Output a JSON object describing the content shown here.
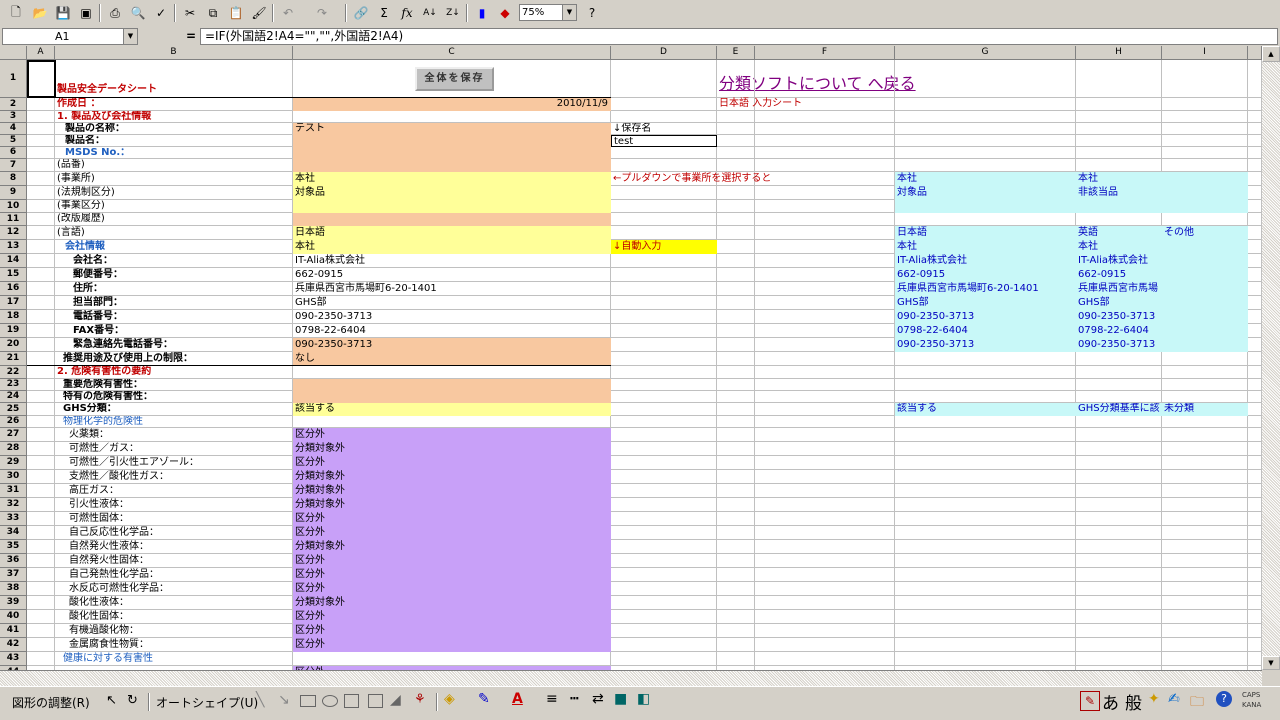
{
  "formula_bar": {
    "cell_ref": "A1",
    "formula": "=IF(外国語2!A4=\"\",\"\",外国語2!A4)"
  },
  "toolbar": {
    "zoom": "75%"
  },
  "columns": [
    "A",
    "B",
    "C",
    "D",
    "E",
    "F",
    "G",
    "H",
    "I"
  ],
  "save_button": "全体を保存",
  "back_link": "分類ソフトについて へ戻る",
  "rows": [
    {
      "n": "1",
      "b": "製品安全データシート",
      "c": "",
      "d": "",
      "g": "",
      "h": "",
      "i": ""
    },
    {
      "n": "2",
      "b": "作成日 ：",
      "c": "2010/11/9",
      "d": "",
      "e": "日本語 入力シート",
      "g": "",
      "h": "",
      "i": ""
    },
    {
      "n": "3",
      "b": "1. 製品及び会社情報",
      "c": "",
      "d": "",
      "g": "",
      "h": "",
      "i": ""
    },
    {
      "n": "4",
      "b": "製品の名称：",
      "c": "テスト",
      "d": "↓保存名",
      "g": "",
      "h": "",
      "i": ""
    },
    {
      "n": "5",
      "b": "製品名：",
      "c": "",
      "d": "test",
      "g": "",
      "h": "",
      "i": ""
    },
    {
      "n": "6",
      "b": "MSDS No.：",
      "c": "",
      "d": "",
      "g": "",
      "h": "",
      "i": ""
    },
    {
      "n": "7",
      "b": "(品番)",
      "c": "",
      "d": "",
      "g": "",
      "h": "",
      "i": ""
    },
    {
      "n": "8",
      "b": "(事業所)",
      "c": "本社",
      "d": "←プルダウンで事業所を選択すると",
      "g": "本社",
      "h": "本社",
      "i": ""
    },
    {
      "n": "9",
      "b": "(法規制区分)",
      "c": "対象品",
      "d": "",
      "g": "対象品",
      "h": "非該当品",
      "i": ""
    },
    {
      "n": "10",
      "b": "(事業区分)",
      "c": "",
      "d": "",
      "g": "",
      "h": "",
      "i": ""
    },
    {
      "n": "11",
      "b": "(改版履歴)",
      "c": "",
      "d": "",
      "g": "",
      "h": "",
      "i": ""
    },
    {
      "n": "12",
      "b": "(言語)",
      "c": "日本語",
      "d": "",
      "g": "日本語",
      "h": "英語",
      "i": "その他"
    },
    {
      "n": "13",
      "b": "会社情報",
      "c": "本社",
      "d": "↓自動入力",
      "g": "本社",
      "h": "本社",
      "i": ""
    },
    {
      "n": "14",
      "b": "会社名：",
      "c": "IT-Alia株式会社",
      "d": "",
      "g": "IT-Alia株式会社",
      "h": "IT-Alia株式会社",
      "i": ""
    },
    {
      "n": "15",
      "b": "郵便番号：",
      "c": "662-0915",
      "d": "",
      "g": "662-0915",
      "h": "662-0915",
      "i": ""
    },
    {
      "n": "16",
      "b": "住所：",
      "c": "兵庫県西宮市馬場町6-20-1401",
      "d": "",
      "g": "兵庫県西宮市馬場町6-20-1401",
      "h": "兵庫県西宮市馬場",
      "i": ""
    },
    {
      "n": "17",
      "b": "担当部門：",
      "c": "GHS部",
      "d": "",
      "g": "GHS部",
      "h": "GHS部",
      "i": ""
    },
    {
      "n": "18",
      "b": "電話番号：",
      "c": "090-2350-3713",
      "d": "",
      "g": "090-2350-3713",
      "h": "090-2350-3713",
      "i": ""
    },
    {
      "n": "19",
      "b": "FAX番号：",
      "c": "0798-22-6404",
      "d": "",
      "g": "0798-22-6404",
      "h": "0798-22-6404",
      "i": ""
    },
    {
      "n": "20",
      "b": "緊急連絡先電話番号：",
      "c": "090-2350-3713",
      "d": "",
      "g": "090-2350-3713",
      "h": "090-2350-3713",
      "i": ""
    },
    {
      "n": "21",
      "b": "推奨用途及び使用上の制限：",
      "c": "なし",
      "d": "",
      "g": "",
      "h": "",
      "i": ""
    },
    {
      "n": "22",
      "b": "2. 危険有害性の要約",
      "c": "",
      "d": "",
      "g": "",
      "h": "",
      "i": ""
    },
    {
      "n": "23",
      "b": "重要危険有害性：",
      "c": "",
      "d": "",
      "g": "",
      "h": "",
      "i": ""
    },
    {
      "n": "24",
      "b": "特有の危険有害性：",
      "c": "",
      "d": "",
      "g": "",
      "h": "",
      "i": ""
    },
    {
      "n": "25",
      "b": "GHS分類：",
      "c": "該当する",
      "d": "",
      "g": "該当する",
      "h": "GHS分類基準に該",
      "i": "未分類"
    },
    {
      "n": "26",
      "b": "物理化学的危険性",
      "c": "",
      "d": "",
      "g": "",
      "h": "",
      "i": ""
    },
    {
      "n": "27",
      "b": "火薬類：",
      "c": "区分外",
      "d": "",
      "g": "",
      "h": "",
      "i": ""
    },
    {
      "n": "28",
      "b": "可燃性／ガス：",
      "c": "分類対象外",
      "d": "",
      "g": "",
      "h": "",
      "i": ""
    },
    {
      "n": "29",
      "b": "可燃性／引火性エアゾール：",
      "c": "区分外",
      "d": "",
      "g": "",
      "h": "",
      "i": ""
    },
    {
      "n": "30",
      "b": "支燃性／酸化性ガス：",
      "c": "分類対象外",
      "d": "",
      "g": "",
      "h": "",
      "i": ""
    },
    {
      "n": "31",
      "b": "高圧ガス：",
      "c": "分類対象外",
      "d": "",
      "g": "",
      "h": "",
      "i": ""
    },
    {
      "n": "32",
      "b": "引火性液体：",
      "c": "分類対象外",
      "d": "",
      "g": "",
      "h": "",
      "i": ""
    },
    {
      "n": "33",
      "b": "可燃性固体：",
      "c": "区分外",
      "d": "",
      "g": "",
      "h": "",
      "i": ""
    },
    {
      "n": "34",
      "b": "自己反応性化学品：",
      "c": "区分外",
      "d": "",
      "g": "",
      "h": "",
      "i": ""
    },
    {
      "n": "35",
      "b": "自然発火性液体：",
      "c": "分類対象外",
      "d": "",
      "g": "",
      "h": "",
      "i": ""
    },
    {
      "n": "36",
      "b": "自然発火性固体：",
      "c": "区分外",
      "d": "",
      "g": "",
      "h": "",
      "i": ""
    },
    {
      "n": "37",
      "b": "自己発熱性化学品：",
      "c": "区分外",
      "d": "",
      "g": "",
      "h": "",
      "i": ""
    },
    {
      "n": "38",
      "b": "水反応可燃性化学品：",
      "c": "区分外",
      "d": "",
      "g": "",
      "h": "",
      "i": ""
    },
    {
      "n": "39",
      "b": "酸化性液体：",
      "c": "分類対象外",
      "d": "",
      "g": "",
      "h": "",
      "i": ""
    },
    {
      "n": "40",
      "b": "酸化性固体：",
      "c": "区分外",
      "d": "",
      "g": "",
      "h": "",
      "i": ""
    },
    {
      "n": "41",
      "b": "有機過酸化物：",
      "c": "区分外",
      "d": "",
      "g": "",
      "h": "",
      "i": ""
    },
    {
      "n": "42",
      "b": "金属腐食性物質：",
      "c": "区分外",
      "d": "",
      "g": "",
      "h": "",
      "i": ""
    },
    {
      "n": "43",
      "b": "健康に対する有害性",
      "c": "",
      "d": "",
      "g": "",
      "h": "",
      "i": ""
    },
    {
      "n": "44",
      "b": "",
      "c": "区分外",
      "d": "",
      "g": "",
      "h": "",
      "i": ""
    }
  ],
  "drawbar": {
    "adjust": "図形の調整(R)",
    "autoshape": "オートシェイプ(U)"
  },
  "ime": {
    "hira": "あ",
    "kan": "般",
    "caps": "CAPS",
    "kana": "KANA"
  }
}
